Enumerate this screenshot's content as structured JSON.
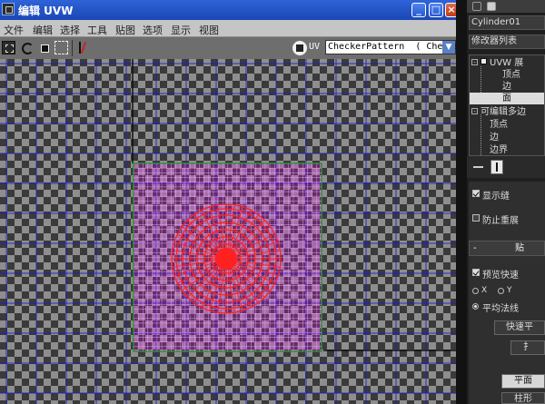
{
  "window": {
    "title": "编辑 UVW",
    "buttons": {
      "minimize": "_",
      "maximize": "□",
      "close": "×"
    }
  },
  "menu": [
    "文件",
    "编辑",
    "选择",
    "工具",
    "贴图",
    "选项",
    "显示",
    "视图"
  ],
  "toolbar": {
    "uv_label": "UV",
    "map_select_value": "CheckerPattern  ( Checker",
    "icons": [
      "move-icon",
      "rotate-icon",
      "scale-icon",
      "freeform-icon",
      "mirror-icon",
      "map-icon"
    ]
  },
  "viewport": {
    "checker_dark": "#3a3a3a",
    "checker_light": "#8e8e8e",
    "grid_color": "#1e1ec8",
    "uv_color": "#ff2020",
    "uv_fill": "#ff00ff",
    "selection_border": "#2e8b3a"
  },
  "command_panel": {
    "object_name": "Cylinder01",
    "modifier_list": "修改器列表",
    "stack": [
      {
        "label": "UVW 展",
        "level": 0,
        "toggle": "-"
      },
      {
        "label": "顶点",
        "level": 1
      },
      {
        "label": "边",
        "level": 1
      },
      {
        "label": "面",
        "level": 1,
        "selected": true
      },
      {
        "label": "可编辑多边",
        "level": 0,
        "toggle": "-"
      },
      {
        "label": "顶点",
        "level": 1
      },
      {
        "label": "边",
        "level": 1
      },
      {
        "label": "边界",
        "level": 1
      }
    ],
    "rollout": {
      "show_seams": "显示缝",
      "prevent_reflatten": "防止重展",
      "mapping_header_minus": "-",
      "mapping_header": "贴",
      "preview_quick": "预览快速",
      "axis_x": "X",
      "axis_y": "Y",
      "average_normals": "平均法线",
      "quick_planar": "快速平",
      "button_fragment": "扌",
      "planar": "平面",
      "cylindrical": "柱形"
    }
  }
}
